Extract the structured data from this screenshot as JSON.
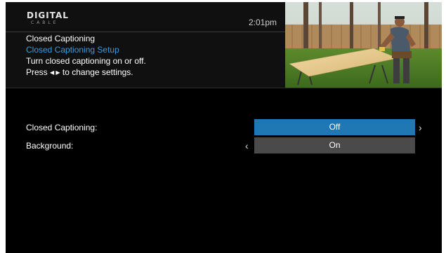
{
  "brand": {
    "name": "DIGITAL",
    "sub": "CABLE"
  },
  "clock": "2:01pm",
  "menu": {
    "title": "Closed Captioning",
    "subtitle": "Closed Captioning Setup",
    "instruction": "Turn closed captioning on or off.",
    "hint_prefix": "Press",
    "hint_arrows": "◀ ▶",
    "hint_suffix": "to change settings."
  },
  "settings": [
    {
      "label": "Closed Captioning:",
      "value": "Off",
      "selected": true
    },
    {
      "label": "Background:",
      "value": "On",
      "selected": false
    }
  ],
  "colors": {
    "accent": "#1f77b4",
    "subtitle": "#3d9be0",
    "option_bg": "#4a4a4a",
    "background": "#000000"
  },
  "icons": {
    "left": "chevron-left-icon",
    "right": "chevron-right-icon"
  }
}
